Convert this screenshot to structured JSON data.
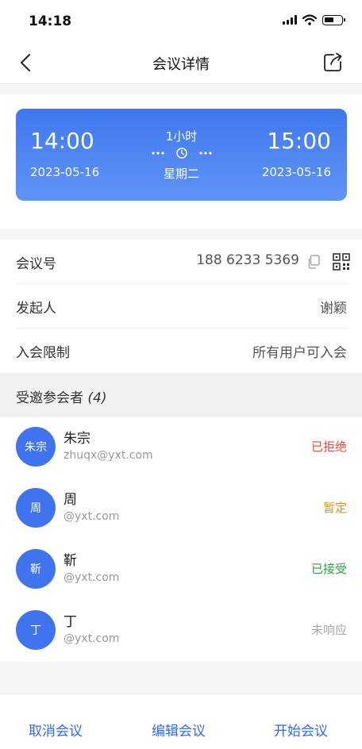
{
  "status_bar": {
    "time": "14:18"
  },
  "nav": {
    "title": "会议详情"
  },
  "time_card": {
    "start_time": "14:00",
    "start_date": "2023-05-16",
    "duration": "1小时",
    "weekday": "星期二",
    "end_time": "15:00",
    "end_date": "2023-05-16"
  },
  "info": {
    "meeting_id_label": "会议号",
    "meeting_id_value": "188 6233 5369",
    "organizer_label": "发起人",
    "organizer_value": "谢颖",
    "restriction_label": "入会限制",
    "restriction_value": "所有用户可入会"
  },
  "invitees": {
    "title": "受邀参会者",
    "count": "(4)",
    "list": [
      {
        "avatar": "朱宗",
        "name": "朱宗",
        "email": "zhuqx@yxt.com",
        "status": "已拒绝",
        "status_color": "#e5493c"
      },
      {
        "avatar": "周",
        "name": "周",
        "email": "@yxt.com",
        "status": "暂定",
        "status_color": "#f0901c"
      },
      {
        "avatar": "靳",
        "name": "靳",
        "email": "@yxt.com",
        "status": "已接受",
        "status_color": "#2fa343"
      },
      {
        "avatar": "丁",
        "name": "丁",
        "email": "@yxt.com",
        "status": "未响应",
        "status_color": "#aaaaaa"
      }
    ]
  },
  "footer": {
    "cancel_label": "取消会议",
    "edit_label": "编辑会议",
    "start_label": "开始会议"
  },
  "colors": {
    "accent": "#2f6df0",
    "card_top": "#3f78ee",
    "card_bottom": "#5f94f6"
  },
  "icons": [
    "back-icon",
    "share-icon",
    "clock-icon",
    "copy-icon",
    "qr-code-icon",
    "signal-icon",
    "wifi-icon",
    "battery-icon"
  ]
}
